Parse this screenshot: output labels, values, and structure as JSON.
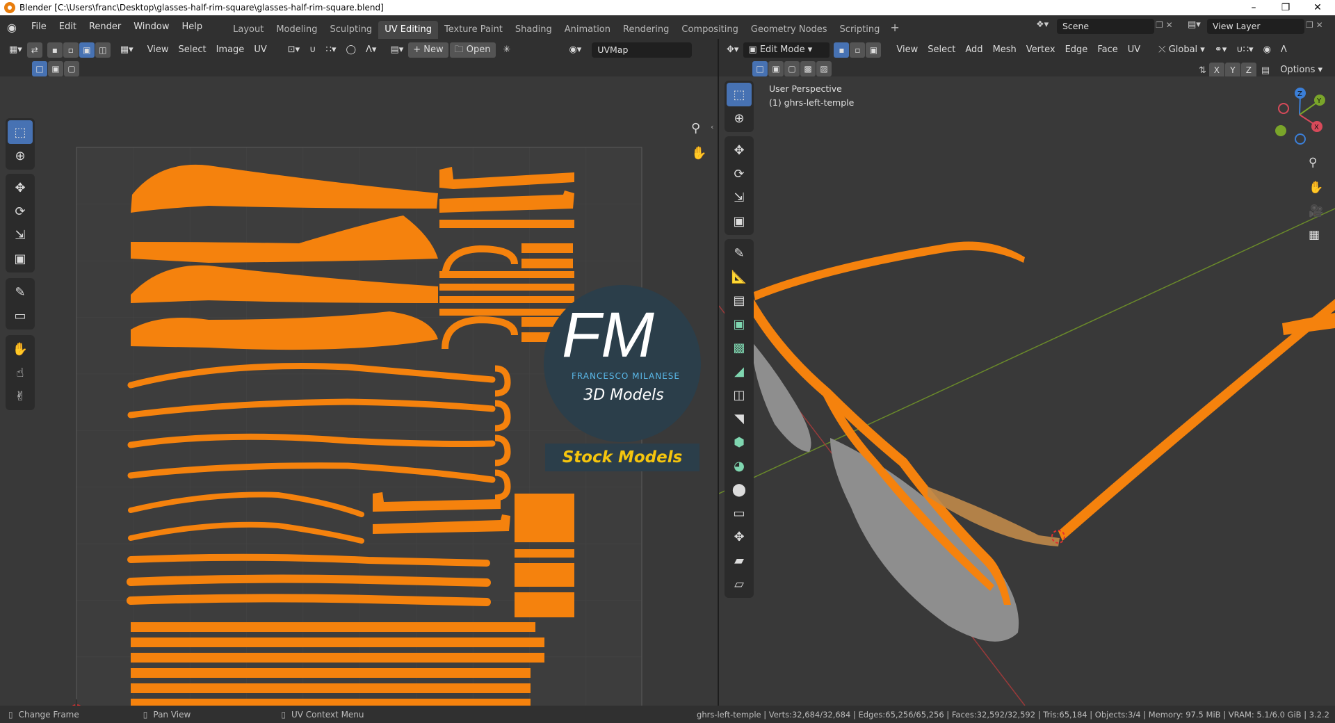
{
  "window": {
    "title": "Blender [C:\\Users\\franc\\Desktop\\glasses-half-rim-square\\glasses-half-rim-square.blend]"
  },
  "menu": [
    "File",
    "Edit",
    "Render",
    "Window",
    "Help"
  ],
  "workspaces": [
    "Layout",
    "Modeling",
    "Sculpting",
    "UV Editing",
    "Texture Paint",
    "Shading",
    "Animation",
    "Rendering",
    "Compositing",
    "Geometry Nodes",
    "Scripting"
  ],
  "active_workspace": "UV Editing",
  "scene": {
    "name": "Scene",
    "view_layer": "View Layer"
  },
  "uv_editor": {
    "menus": [
      "View",
      "Select",
      "Image",
      "UV"
    ],
    "new_label": "New",
    "open_label": "Open",
    "uvmap": "UVMap"
  },
  "viewport": {
    "mode": "Edit Mode",
    "menus": [
      "View",
      "Select",
      "Add",
      "Mesh",
      "Vertex",
      "Edge",
      "Face",
      "UV"
    ],
    "orientation": "Global",
    "options_label": "Options",
    "axes": [
      "X",
      "Y",
      "Z"
    ],
    "perspective": "User Perspective",
    "object_label": "(1) ghrs-left-temple"
  },
  "watermark": {
    "fm": "FM",
    "brand": "FRANCESCO MILANESE",
    "subtitle": "3D Models",
    "stock": "Stock Models"
  },
  "status": {
    "left": "Change Frame",
    "middle": "Pan View",
    "right": "UV Context Menu",
    "stats": "ghrs-left-temple | Verts:32,684/32,684 | Edges:65,256/65,256 | Faces:32,592/32,592 | Tris:65,184 | Objects:3/4 | Memory: 97.5 MiB | VRAM: 5.1/6.0 GiB | 3.2.2"
  },
  "colors": {
    "accent": "#4772b3",
    "selection": "#f5820d",
    "panel": "#303030",
    "viewport": "#393939"
  }
}
